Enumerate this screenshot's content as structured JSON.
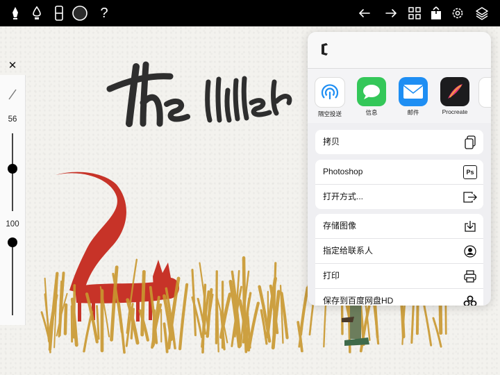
{
  "toolbar": {
    "left_icons": [
      "pen-tool-icon",
      "ink-drop-icon",
      "eraser-icon",
      "color-circle-icon",
      "help-icon"
    ],
    "help_glyph": "?",
    "right_icons": [
      "undo-icon",
      "redo-icon",
      "grid-icon",
      "share-icon",
      "settings-icon",
      "layers-icon"
    ],
    "bg_color": "#000000"
  },
  "side_panel": {
    "close_glyph": "✕",
    "brush_icon": "brush-stroke-icon",
    "size_value": "56",
    "size_level": 0.55,
    "opacity_value": "100",
    "opacity_level": 1.0
  },
  "share_sheet": {
    "file_icon": "document-c-icon",
    "apps": [
      {
        "label": "隔空投送",
        "icon": "airdrop-icon",
        "color": "#ffffff"
      },
      {
        "label": "信息",
        "icon": "messages-icon",
        "color": "#34c759"
      },
      {
        "label": "邮件",
        "icon": "mail-icon",
        "color": "#1e8ef3"
      },
      {
        "label": "Procreate",
        "icon": "procreate-icon",
        "color": "#1c1c1e"
      }
    ],
    "groups": [
      [
        {
          "label": "拷贝",
          "icon": "copy-icon"
        }
      ],
      [
        {
          "label": "Photoshop",
          "icon": "photoshop-icon",
          "icon_text": "Ps"
        },
        {
          "label": "打开方式...",
          "icon": "open-in-icon"
        }
      ],
      [
        {
          "label": "存储图像",
          "icon": "save-image-icon"
        },
        {
          "label": "指定给联系人",
          "icon": "assign-contact-icon"
        },
        {
          "label": "打印",
          "icon": "print-icon"
        },
        {
          "label": "保存到百度网盘HD",
          "icon": "baidu-netdisk-icon"
        }
      ]
    ]
  },
  "canvas": {
    "title_text": "The little",
    "accent_red": "#c73328",
    "grass_color": "#c9982f"
  }
}
